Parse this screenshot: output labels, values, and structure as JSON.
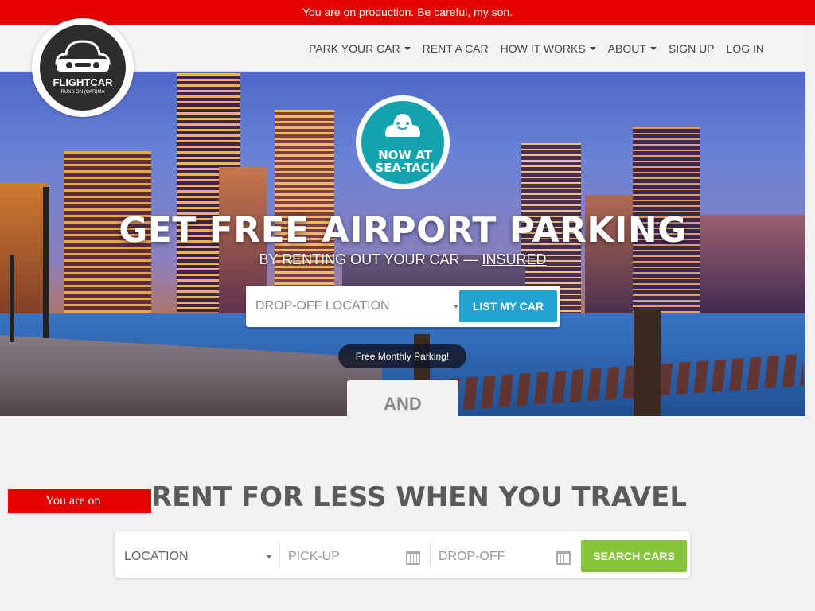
{
  "prod_banner": "You are on production. Be careful, my son.",
  "logo": {
    "brand": "FLIGHTCAR",
    "tagline": "RUNS ON (CAR)MA"
  },
  "nav": {
    "items": [
      {
        "label": "PARK YOUR CAR",
        "dropdown": true
      },
      {
        "label": "RENT A CAR",
        "dropdown": false
      },
      {
        "label": "HOW IT WORKS",
        "dropdown": true
      },
      {
        "label": "ABOUT",
        "dropdown": true
      },
      {
        "label": "SIGN UP",
        "dropdown": false
      },
      {
        "label": "LOG IN",
        "dropdown": false
      }
    ]
  },
  "hero": {
    "badge_line1": "NOW AT",
    "badge_line2": "SEA-TAC!",
    "title": "GET FREE AIRPORT PARKING",
    "subtitle_pre": "BY RENTING OUT YOUR CAR — ",
    "subtitle_link": "INSURED",
    "dropoff_placeholder": "DROP-OFF LOCATION",
    "list_button": "LIST MY CAR",
    "monthly_pill": "Free Monthly Parking!",
    "and_label": "AND"
  },
  "side_badge": "You are on",
  "rent": {
    "title": "RENT FOR LESS WHEN YOU TRAVEL",
    "location_placeholder": "LOCATION",
    "pickup_placeholder": "PICK-UP",
    "dropoff_placeholder": "DROP-OFF",
    "search_button": "SEARCH CARS"
  },
  "colors": {
    "prod_red": "#e50000",
    "teal": "#13a3ad",
    "list_blue": "#23a3cf",
    "search_green": "#86c43a"
  }
}
